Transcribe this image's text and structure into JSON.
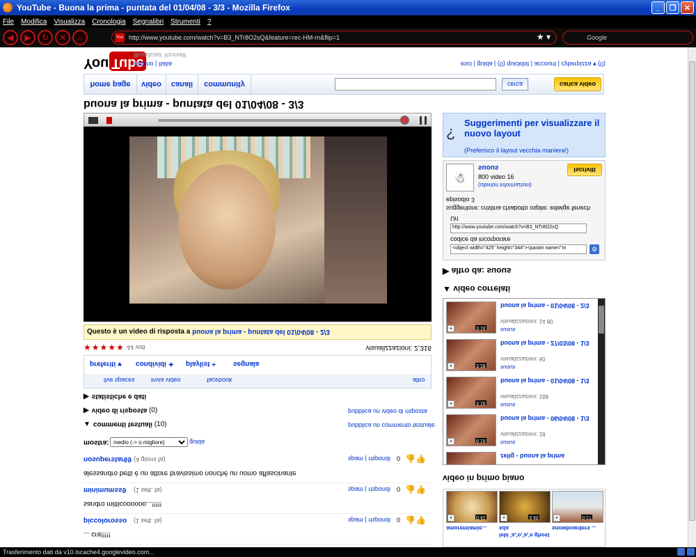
{
  "window": {
    "title": "YouTube - Buona la prima - puntata del 01/04/08 - 3/3 - Mozilla Firefox"
  },
  "menu": {
    "items": [
      "File",
      "Modifica",
      "Visualizza",
      "Cronologia",
      "Segnalibri",
      "Strumenti",
      "?"
    ]
  },
  "navbar": {
    "url": "http://www.youtube.com/watch?v=B3_NTr8O2sQ&feature=rec-HM-rn&flip=1",
    "search_placeholder": "Google"
  },
  "header": {
    "logo_you": "You",
    "logo_tube": "Tube",
    "tagline": "Broadcast Yourself",
    "lang_line": "italiano | Italia",
    "user_links": "esci | guida | (0) quicklist | account | cyberpizza ▾ (0)"
  },
  "tabs": {
    "home": "home page",
    "video": "video",
    "canali": "canali",
    "community": "community",
    "cerca": "cerca",
    "upload": "carica video"
  },
  "page_title": "buona la prima - puntata del 01/04/08 - 3/3",
  "response": {
    "prefix": "Questo è un video di risposta a ",
    "link": "buona la prima - puntata del 01/04/08 - 2/3"
  },
  "rating": {
    "stars": "★★★★★",
    "votes": "44 voti",
    "views": "visualizzazioni: 2,316"
  },
  "actions": {
    "preferiti": "preferiti",
    "condividi": "condividi",
    "playlist": "playlist",
    "segnala": "segnala",
    "altro": "altro",
    "facebook": "facebook",
    "invia": "invia video",
    "spaces": "live spaces"
  },
  "sections": {
    "stats": "statistiche e dati",
    "risposte": "video di risposta",
    "risposte_count": "(0)",
    "risposte_link": "pubblica un video di risposta",
    "commenti": "commenti testuali",
    "commenti_count": "(10)",
    "commenti_link": "pubblica un commento testuale"
  },
  "sort": {
    "mostra": "mostra:",
    "option": "medio (-> o migliore)",
    "guida": "guida"
  },
  "comments": [
    {
      "user": "nosuperstar69",
      "age": "(4 giorni fa)",
      "text": "alessandro betti è un attore bravissimo nonché un uomo affascinante",
      "links": "spam | rispondi",
      "score": "0"
    },
    {
      "user": "minimumss9",
      "age": "(1 sett. fa)",
      "text": "sandro mitticoooooo...!!!!!",
      "links": "spam | rispondi",
      "score": "0"
    },
    {
      "user": "piccolorosso",
      "age": "(1 sett. fa)",
      "text": "... cra!!!!!",
      "links": "spam | rispondi",
      "score": "0"
    }
  ],
  "suggest": {
    "title": "Suggerimenti per visualizzare il nuovo layout",
    "pref": "(Preferisco il layout vecchia maniera!)"
  },
  "author": {
    "name": "suous",
    "count": "800 video 16",
    "info": "(ulteriori informazioni)",
    "iscriviti": "Iscriviti",
    "desc": "suggeritore: cristina chiabotto ospite: edwige fenech episodio 3",
    "url_label": "Url",
    "url_value": "http://www.youtube.com/watch?v=B3_NTr8O2sQ",
    "embed_label": "codice da incorporare",
    "embed_value": "<object width=\"425\" height=\"344\"><param name=\"m"
  },
  "more_from": "altro da: suous",
  "related_head": "video correlati",
  "related": [
    {
      "title": "buona la prima - 01/04/08 - 2/3",
      "views": "visualizzazioni: 14 80",
      "author": "suous",
      "dur": "3:16"
    },
    {
      "title": "buona la prima - 27/03/08 - 1/3",
      "views": "visualizzazioni: 60",
      "author": "suous",
      "dur": "3:28"
    },
    {
      "title": "buona la prima - 01/04/08 - 1/3",
      "views": "visualizzazioni: 168",
      "author": "suous",
      "dur": "3:16"
    },
    {
      "title": "buona la prima - 06/04/08 - 1/3",
      "views": "visualizzazioni: 18",
      "author": "suous",
      "dur": "6:16"
    },
    {
      "title": "zelig - buona la prima",
      "views": "",
      "author": "",
      "dur": ""
    }
  ],
  "featured_head": "video in primo piano",
  "featured": [
    {
      "title": "amoremiamie...",
      "dur": "0:41"
    },
    {
      "title": "lebi 'a,'o,'a,'e ghost sda",
      "dur": "3:45"
    },
    {
      "title": "snowboarders ...",
      "dur": "0:17"
    }
  ],
  "status": "Trasferimento dati da v10.lscache4.googlevideo.com..."
}
